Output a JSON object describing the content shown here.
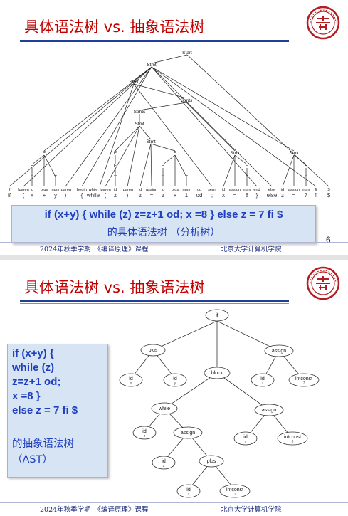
{
  "slide1": {
    "title": "具体语法树 vs. 抽象语法树",
    "tree": {
      "nodes": {
        "Start": "Start",
        "Stmt_top": "Stmt",
        "Stmt_mid": "Stmt",
        "Stmts_a": "Stmts",
        "Stmts_b": "Stmts",
        "Stmt_while": "Stmt",
        "Stmt_assign1": "Stmt",
        "Stmt_assign2": "Stmt",
        "Stmt_assign3": "Stmt",
        "E": "E",
        "T": "T"
      },
      "leaf_tokens": [
        "if",
        "lparen",
        "id",
        "plus",
        "num",
        "rparen",
        "begin",
        "while",
        "lparen",
        "id",
        "rparen",
        "id",
        "assign",
        "id",
        "plus",
        "num",
        "od",
        "semi",
        "id",
        "assign",
        "num",
        "end",
        "else",
        "id",
        "assign",
        "num",
        "fi",
        "$"
      ],
      "leaf_chars": [
        "if",
        "(",
        "x",
        "+",
        "y",
        ")",
        "{",
        "while",
        "(",
        "z",
        ")",
        "z",
        "=",
        "z",
        "+",
        "1",
        "od",
        ";",
        "x",
        "=",
        "8",
        "}",
        "else",
        "z",
        "=",
        "7",
        "fi",
        "$"
      ]
    },
    "caption_line1": "if (x+y) { while (z) z=z+1 od; x =8 } else z = 7 fi $",
    "caption_line2": "的具体语法树 （分析树）",
    "page_number": "6",
    "footer_left": "2024年秋季学期　《编译原理》课程",
    "footer_right": "北京大学计算机学院"
  },
  "slide2": {
    "title": "具体语法树 vs. 抽象语法树",
    "code_lines": [
      "if (x+y) {",
      "while (z)",
      "z=z+1 od;",
      "x =8 }",
      "else z = 7 fi $"
    ],
    "caption_line1": "的抽象语法树",
    "caption_line2": "（AST）",
    "ast": {
      "if": "if",
      "plus_top": "plus",
      "assign_top": "assign",
      "id_x": "id",
      "id_x_sub": "x",
      "id_y": "id",
      "id_y_sub": "y",
      "block": "block",
      "id_z_top": "id",
      "id_z_top_sub": "z",
      "intconst_7": "intconst",
      "intconst_7_sub": "7",
      "while": "while",
      "assign_mid": "assign",
      "id_z_w": "id",
      "id_z_w_sub": "z",
      "assign_inner": "assign",
      "id_x2": "id",
      "id_x2_sub": "x",
      "intconst_8": "intconst",
      "intconst_8_sub": "8",
      "id_z_a": "id",
      "id_z_a_sub": "z",
      "plus_inner": "plus",
      "id_z_p": "id",
      "id_z_p_sub": "z",
      "intconst_1": "intconst",
      "intconst_1_sub": "1"
    },
    "footer_left": "2024年秋季学期　《编译原理》课程",
    "footer_right": "北京大学计算机学院"
  },
  "colors": {
    "title": "#c00000",
    "accent_bar": "#1f3f99",
    "caption_text": "#1f3fbf",
    "caption_bg": "#d7e4f3",
    "seal": "#b41e23"
  }
}
